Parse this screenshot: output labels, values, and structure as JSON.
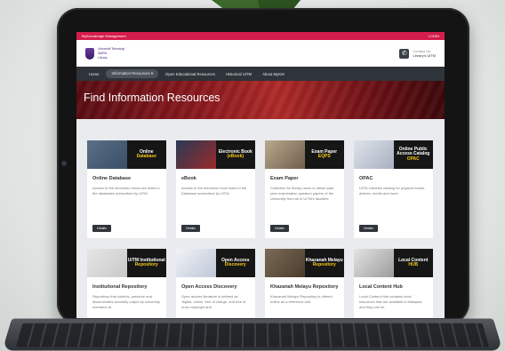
{
  "topbar": {
    "left": "MyKnowledge Management",
    "right": "LOGIN"
  },
  "header": {
    "logo_line1": "Universiti Teknologi",
    "logo_line2": "MARA",
    "logo_line3": "Library",
    "contact_label": "Contact Us",
    "contact_value": "Library's UiTM"
  },
  "nav": {
    "items": [
      "Home",
      "Information Resources ▾",
      "Open Educational Resources",
      "Historical UiTM",
      "About MyKM"
    ]
  },
  "hero": {
    "title": "Find Information Resources"
  },
  "cards": [
    {
      "label": "Online",
      "sublabel": "Database",
      "title": "Online Database",
      "desc": "Access to the electronic resources listed in the databases subscribed by UiTM",
      "button": "Details",
      "color1": "#5b6f87",
      "color2": "#3a4f66"
    },
    {
      "label": "Electronic Book",
      "sublabel": "(eBook)",
      "title": "eBook",
      "desc": "Access to the electronic book listed in the Database subscribed by UiTM",
      "button": "Details",
      "color1": "#273a56",
      "color2": "#9b2a2a"
    },
    {
      "label": "Exam Paper",
      "sublabel": "EQPS",
      "title": "Exam Paper",
      "desc": "Collection for library users to obtain past year examination question papers of the University from all of UiTM's faculties",
      "button": "Details",
      "color1": "#b9a98f",
      "color2": "#6f5f4b"
    },
    {
      "label": "Online Public Access Catalog",
      "sublabel": "OPAC",
      "title": "OPAC",
      "desc": "UiTM Libraries catalog for physical books, articles, media and more",
      "button": "Details",
      "color1": "#dfe3ea",
      "color2": "#a7b1c1"
    },
    {
      "label": "UiTM Institutional",
      "sublabel": "Repository",
      "title": "Institutional Repository",
      "desc": "Repository that collects, preserve and disseminates scholarly output by university members at",
      "button": "",
      "color1": "#e6e6e6",
      "color2": "#c9c9c9"
    },
    {
      "label": "Open Access",
      "sublabel": "Discovery",
      "title": "Open Access Discovery",
      "desc": "Open access literature is defined as 'digital, online, free of charge, and free of most copyright and",
      "button": "",
      "color1": "#f0f2f6",
      "color2": "#bfc8d8"
    },
    {
      "label": "Khazanah Melayu",
      "sublabel": "Repository",
      "title": "Khazanah Melayu Repository",
      "desc": "Khazanah Melayu Repository is offered online as a reference and",
      "button": "",
      "color1": "#7b6a56",
      "color2": "#4a3c2d"
    },
    {
      "label": "Local Content",
      "sublabel": "HUB",
      "title": "Local Content Hub",
      "desc": "Local Content Hub contains local resources that are available in Malaysia and they can be",
      "button": "",
      "color1": "#e4e4e4",
      "color2": "#9b9b9b"
    }
  ],
  "colors": {
    "topbar": "#d31d4b",
    "navbar": "#2f333a",
    "hero": "#8c1a1f",
    "accent": "#f4c81a"
  }
}
